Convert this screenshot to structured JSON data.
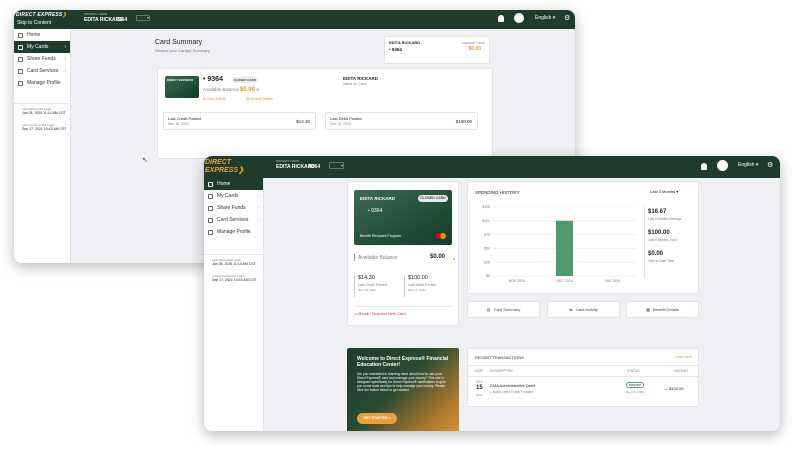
{
  "brand": {
    "name": "DIRECT EXPRESS",
    "accent": "#e8a03a",
    "header_bg": "#1e3b2c",
    "chart_green": "#4e9a6b",
    "orange": "#e49a2b"
  },
  "skip_link": "Skip to Content",
  "header": {
    "card_label": "PRIMARY CARD",
    "user_name": "EDITA RICKARD",
    "card_number": "9364",
    "language": "English"
  },
  "nav": [
    {
      "label": "Home"
    },
    {
      "label": "My Cards"
    },
    {
      "label": "Share Funds"
    },
    {
      "label": "Card Services"
    },
    {
      "label": "Manage Profile"
    }
  ],
  "login_info": {
    "last_success_label": "Last Successful Login",
    "last_success_value": "Jan 28, 2025 11:14 AM CST",
    "last_unsuccess_label": "Last Unsuccessful Login",
    "last_unsuccess_value": "Sep 17, 2021 10:43 AM CST"
  },
  "summary": {
    "title": "Card Summary",
    "subtitle": "Review your Card(s) Summary",
    "mini_name": "EDITA RICKARD",
    "mini_card_label": "PRIMARY CARD",
    "mini_number": "• 9364",
    "mini_balance": "$0.00",
    "card_number": "• 9364",
    "status_badge": "CLOSED CARD",
    "available_balance_label": "Available Balance",
    "available_balance": "$0.00",
    "view_activity": "View Activity",
    "benefit_details": "Benefit Details",
    "name_value": "EDITA RICKARD",
    "name_label": "Name on Card",
    "credit_label": "Last Credit Posted",
    "credit_date": "Nov 18, 2024",
    "credit_value": "$14.30",
    "debit_label": "Last Debit Posted",
    "debit_date": "Dec 15, 2024",
    "debit_value": "$100.00"
  },
  "home": {
    "card_name": "EDITA RICKARD",
    "card_badge": "CLOSED CARD",
    "card_number": "• 9364",
    "card_program": "Benefit Recipient Program",
    "available_balance_label": "Available Balance",
    "available_balance": "$0.00",
    "credit_value": "$14.30",
    "credit_label": "Last Credit Posted",
    "credit_date": "Nov 18, 2024",
    "debit_value": "$100.00",
    "debit_label": "Last Debit Posted",
    "debit_date": "Dec 15, 2024",
    "replace_link": "Block / Request New Card",
    "promo": {
      "title": "Welcome to Direct Express® Financial Education Center!",
      "body": "Are you interested in learning more about how to use your Direct Express® card and manage your money? This site is designed specifically for Direct Express® cardholders to give you some tools and tips to help manage your money. Please click the button below to get started.",
      "button": "GET STARTED »"
    },
    "spending": {
      "title": "SPENDING HISTORY",
      "range": "Last 3 Months",
      "stat1_value": "$16.67",
      "stat1_label": "Last 6 Months Average",
      "stat2_value": "$100.00",
      "stat2_label": "Last 6 Months Total",
      "stat3_value": "$0.00",
      "stat3_label": "Year to Date Total"
    },
    "actions": [
      {
        "label": "Card Summary"
      },
      {
        "label": "Card Activity"
      },
      {
        "label": "Benefit Details"
      }
    ],
    "transactions": {
      "title": "RECENT TRANSACTIONS",
      "view_more": "View More",
      "col_date": "DATE",
      "col_description": "DESCRIPTION",
      "col_status": "STATUS",
      "col_amount": "AMOUNT",
      "rows": [
        {
          "month": "DEC",
          "day": "15",
          "year": "2024",
          "description": "CMA Administrative Debit",
          "sub": "Batch Debit Funds Transfer",
          "status": "POSTED",
          "status_date": "Dec 15, 2024",
          "amount": "— $100.00"
        }
      ]
    }
  },
  "chart_data": {
    "type": "bar",
    "categories": [
      "NOV 2024",
      "DEC 2024",
      "JAN 2025"
    ],
    "values": [
      0,
      100,
      0
    ],
    "yticks": [
      "$125",
      "$100",
      "$75",
      "$50",
      "$25",
      "$0"
    ],
    "ylim": [
      0,
      125
    ],
    "grid": true
  }
}
